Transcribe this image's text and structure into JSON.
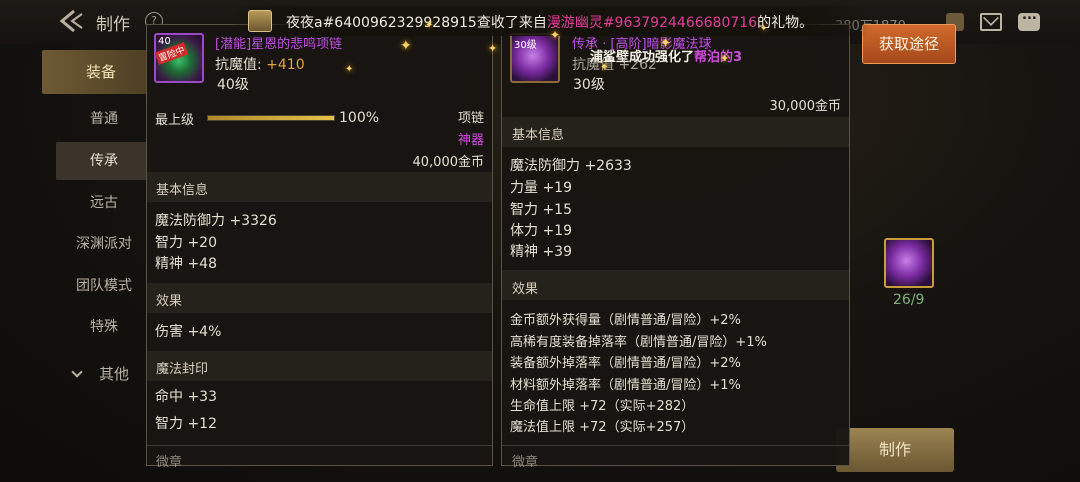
{
  "header": {
    "title": "制作",
    "help": "?",
    "currency_partial": "380万1870"
  },
  "broadcast": {
    "player": "夜夜a#6400962329928915",
    "action": "查收了来自",
    "sender": "漫游幽灵#9637924466680716",
    "suffix": "的礼物。"
  },
  "notice": {
    "prefix": "浦鲨壁成功强化了",
    "item": "帮泊的3"
  },
  "sidebar": {
    "categories": [
      {
        "label": "装备",
        "active": true
      },
      {
        "label": "其他",
        "active": false
      }
    ],
    "items": [
      {
        "label": "普通"
      },
      {
        "label": "传承",
        "selected": true
      },
      {
        "label": "远古"
      },
      {
        "label": "深渊派对"
      },
      {
        "label": "团队模式"
      },
      {
        "label": "特殊"
      }
    ]
  },
  "buttons": {
    "obtain": "获取途径",
    "craft": "制作"
  },
  "material": {
    "count": "26/9"
  },
  "left_card": {
    "icon_level": "40",
    "icon_badge": "冒险中",
    "name": "[潜能]星恩的悲鸣项链",
    "stat_line_label": "抗魔值:",
    "stat_line_value": "+410",
    "level": "40级",
    "grade_label": "最上级",
    "grade_percent": "100%",
    "grade_fraction": 1.0,
    "slot": "项链",
    "rarity": "神器",
    "price": "40,000金币",
    "basic_title": "基本信息",
    "basic": [
      "魔法防御力 +3326",
      "智力 +20",
      "精神 +48"
    ],
    "effect_title": "效果",
    "effects": [
      "伤害 +4%"
    ],
    "seal_title": "魔法封印",
    "seals": [
      "命中 +33",
      "智力 +12"
    ],
    "footer_partial": "微章"
  },
  "right_card": {
    "icon_level": "30级",
    "name": "传承 · [高阶]暗影魔法球",
    "stat_line": "抗魔值 +262",
    "level": "30级",
    "price": "30,000金币",
    "basic_title": "基本信息",
    "basic": [
      "魔法防御力 +2633",
      "力量 +19",
      "智力 +15",
      "体力 +19",
      "精神 +39"
    ],
    "effect_title": "效果",
    "effects": [
      "金币额外获得量（剧情普通/冒险）+2%",
      "高稀有度装备掉落率（剧情普通/冒险）+1%",
      "装备额外掉落率（剧情普通/冒险）+2%",
      "材料额外掉落率（剧情普通/冒险）+1%",
      "生命值上限 +72（实际+282）",
      "魔法值上限 +72（实际+257）"
    ],
    "footer_partial": "微章"
  },
  "colors": {
    "accent_orange": "#c25a22",
    "epic_purple": "#c24ce8",
    "gold": "#e0a33a"
  }
}
